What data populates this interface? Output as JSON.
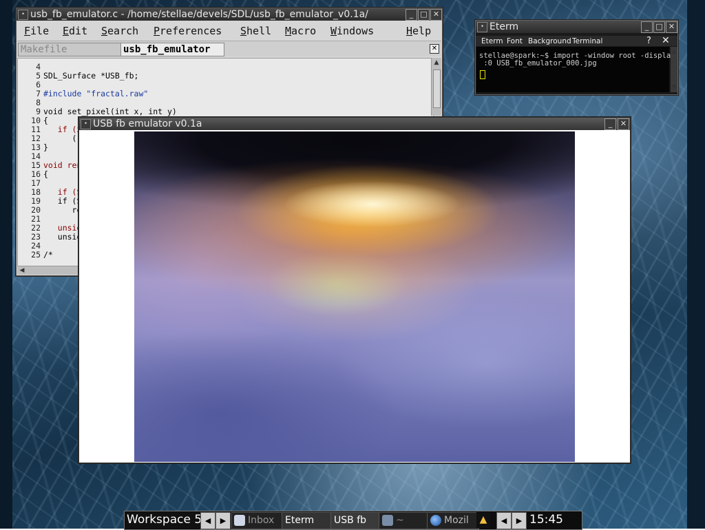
{
  "editor": {
    "title": "usb_fb_emulator.c - /home/stellae/devels/SDL/usb_fb_emulator_v0.1a/",
    "menu": [
      "File",
      "Edit",
      "Search",
      "Preferences",
      "Shell",
      "Macro",
      "Windows",
      "Help"
    ],
    "tabs": [
      "Makefile",
      "usb_fb_emulator"
    ],
    "code_lines": [
      {
        "num": "4",
        "text": ""
      },
      {
        "num": "5",
        "text": "SDL_Surface *USB_fb;"
      },
      {
        "num": "6",
        "text": ""
      },
      {
        "num": "7",
        "text": "#include \"fractal.raw\""
      },
      {
        "num": "8",
        "text": ""
      },
      {
        "num": "9",
        "text": "void set_pixel(int x, int y)"
      },
      {
        "num": "10",
        "text": "{"
      },
      {
        "num": "11",
        "text": "   if (x"
      },
      {
        "num": "12",
        "text": "      ("
      },
      {
        "num": "13",
        "text": "}"
      },
      {
        "num": "14",
        "text": ""
      },
      {
        "num": "15",
        "text": "void ren"
      },
      {
        "num": "16",
        "text": "{"
      },
      {
        "num": "17",
        "text": ""
      },
      {
        "num": "18",
        "text": "   if (S"
      },
      {
        "num": "19",
        "text": "   if (S"
      },
      {
        "num": "20",
        "text": "      re"
      },
      {
        "num": "21",
        "text": ""
      },
      {
        "num": "22",
        "text": "   unsig"
      },
      {
        "num": "23",
        "text": "   unsig"
      },
      {
        "num": "24",
        "text": ""
      },
      {
        "num": "25",
        "text": "/*"
      }
    ]
  },
  "eterm": {
    "title": "Eterm",
    "menu": [
      "Eterm",
      "Font",
      "Background",
      "Terminal"
    ],
    "help_button": "?",
    "line1": "stellae@spark:~$ import -window root -display",
    "line2": " :0 USB_fb_emulator_000.jpg"
  },
  "emulator": {
    "title": "USB fb emulator v0.1a"
  },
  "taskbar": {
    "workspace": "Workspace 5",
    "tasks": [
      "Inbox",
      "Eterm",
      "USB fb",
      "~",
      "Mozil"
    ],
    "clock": "15:45"
  },
  "colors": {
    "accent_keyword": "#8b0000",
    "accent_string": "#1a3aa0",
    "cursor": "#e6e600"
  }
}
